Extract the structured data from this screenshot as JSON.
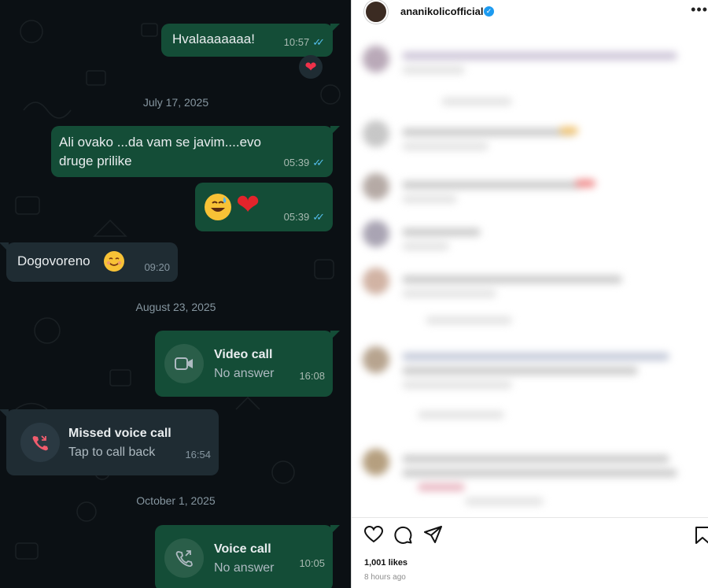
{
  "chat": {
    "messages": [
      {
        "type": "text",
        "dir": "out",
        "text": "Hvalaaaaaaa!",
        "time": "10:57",
        "reaction": "heart"
      },
      {
        "type": "date",
        "text": "July 17, 2025"
      },
      {
        "type": "text",
        "dir": "out",
        "text_line1": "Ali ovako ...da vam se javim....evo",
        "text_line2": "druge prilike",
        "time": "05:39"
      },
      {
        "type": "emoji",
        "dir": "out",
        "emojis": [
          "grinning-sweat-emoji",
          "red-heart-emoji"
        ],
        "time": "05:39"
      },
      {
        "type": "text",
        "dir": "in",
        "text": "Dogovoreno",
        "emoji": "smiling-emoji",
        "time": "09:20"
      },
      {
        "type": "date",
        "text": "August 23, 2025"
      },
      {
        "type": "call",
        "dir": "out",
        "icon": "video-camera-icon",
        "title": "Video call",
        "subtitle": "No answer",
        "time": "16:08"
      },
      {
        "type": "call",
        "dir": "in",
        "icon": "missed-call-icon",
        "title": "Missed voice call",
        "subtitle": "Tap to call back",
        "time": "16:54"
      },
      {
        "type": "date",
        "text": "October 1, 2025"
      },
      {
        "type": "call",
        "dir": "out",
        "icon": "phone-outgoing-icon",
        "title": "Voice call",
        "subtitle": "No answer",
        "time": "10:05"
      }
    ],
    "colors": {
      "background": "#0b1014",
      "outgoing": "#144d37",
      "incoming": "#1f2c33",
      "ticks": "#53bdeb",
      "missed": "#f15c6d"
    }
  },
  "instagram": {
    "username": "ananikolicofficial",
    "verified": true,
    "more_icon": "more-dots-icon",
    "actions": [
      "heart-icon",
      "comment-icon",
      "share-icon",
      "bookmark-icon"
    ],
    "likes": "1,001 likes",
    "time_ago": "8 hours ago"
  }
}
